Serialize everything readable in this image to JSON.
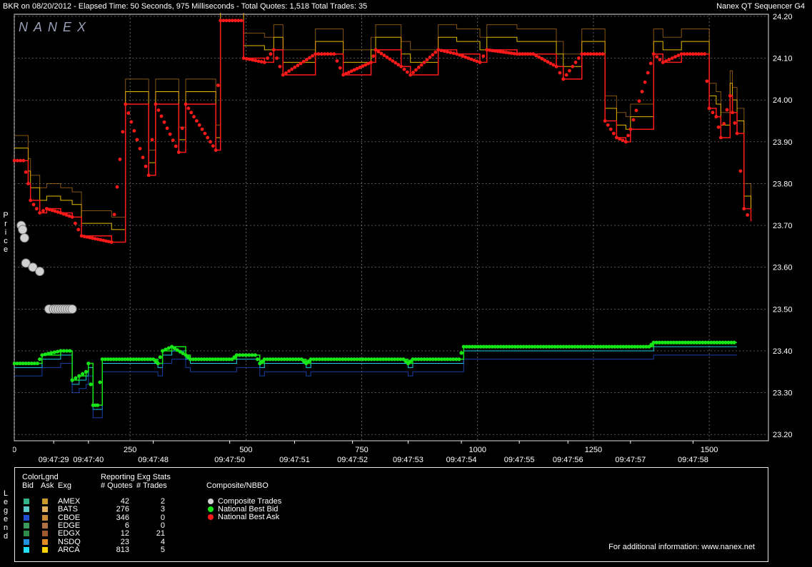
{
  "header": {
    "title": "BKR on 08/20/2012  -  Elapsed Time: 50 Seconds, 975 Milliseconds  -  Total Quotes: 1,518  Total Trades: 35",
    "brand": "Nanex QT Sequencer G4",
    "logo": "NANEX"
  },
  "colors": {
    "bid": "#16e616",
    "ask": "#ff1a1a",
    "trade": "#d0d0d0",
    "grid": "#8a8a8a",
    "amex_bid": "#34b38a",
    "amex_ask": "#c79a2b",
    "bats_bid": "#5ec9c9",
    "bats_ask": "#e0b060",
    "cboe_bid": "#1f4fd0",
    "cboe_ask": "#c98a3a",
    "edge_bid": "#3a9a5a",
    "edge_ask": "#b07040",
    "edgx_bid": "#2e8a4a",
    "edgx_ask": "#a05a30",
    "nsdq_bid": "#2090e0",
    "nsdq_ask": "#e08a20",
    "arca_bid": "#22e0ff",
    "arca_ask": "#ffd000"
  },
  "chart_data": {
    "type": "line",
    "ylabel": "Price",
    "ylim": [
      23.185,
      24.205
    ],
    "xlim": [
      0,
      1600
    ],
    "y_ticks": [
      "24.20",
      "24.10",
      "24.00",
      "23.90",
      "23.80",
      "23.70",
      "23.60",
      "23.50",
      "23.40",
      "23.30",
      "23.20"
    ],
    "x_ticks": [
      {
        "x": 0,
        "label": "0"
      },
      {
        "x": 250,
        "label": "250"
      },
      {
        "x": 500,
        "label": "500"
      },
      {
        "x": 750,
        "label": "750"
      },
      {
        "x": 1000,
        "label": "1000"
      },
      {
        "x": 1250,
        "label": "1250"
      },
      {
        "x": 1500,
        "label": "1500"
      }
    ],
    "time_ticks": [
      {
        "x": 85,
        "label": "09:47:29"
      },
      {
        "x": 160,
        "label": "09:47:40"
      },
      {
        "x": 300,
        "label": "09:47:48"
      },
      {
        "x": 465,
        "label": "09:47:50"
      },
      {
        "x": 605,
        "label": "09:47:51"
      },
      {
        "x": 730,
        "label": "09:47:52"
      },
      {
        "x": 850,
        "label": "09:47:53"
      },
      {
        "x": 965,
        "label": "09:47:54"
      },
      {
        "x": 1090,
        "label": "09:47:55"
      },
      {
        "x": 1195,
        "label": "09:47:56"
      },
      {
        "x": 1330,
        "label": "09:47:57"
      },
      {
        "x": 1465,
        "label": "09:47:58"
      }
    ],
    "series": [
      {
        "name": "National Best Ask",
        "points": [
          [
            0,
            23.855
          ],
          [
            20,
            23.855
          ],
          [
            30,
            23.8
          ],
          [
            35,
            23.76
          ],
          [
            55,
            23.73
          ],
          [
            70,
            23.74
          ],
          [
            100,
            23.73
          ],
          [
            125,
            23.72
          ],
          [
            145,
            23.675
          ],
          [
            210,
            23.66
          ],
          [
            240,
            23.99
          ],
          [
            290,
            23.82
          ],
          [
            305,
            23.99
          ],
          [
            355,
            23.875
          ],
          [
            370,
            23.99
          ],
          [
            435,
            23.88
          ],
          [
            445,
            24.19
          ],
          [
            490,
            24.19
          ],
          [
            495,
            24.1
          ],
          [
            540,
            24.09
          ],
          [
            560,
            24.12
          ],
          [
            580,
            24.06
          ],
          [
            650,
            24.11
          ],
          [
            690,
            24.11
          ],
          [
            710,
            24.06
          ],
          [
            770,
            24.09
          ],
          [
            780,
            24.12
          ],
          [
            835,
            24.08
          ],
          [
            855,
            24.06
          ],
          [
            915,
            24.12
          ],
          [
            955,
            24.11
          ],
          [
            1005,
            24.09
          ],
          [
            1020,
            24.12
          ],
          [
            1085,
            24.11
          ],
          [
            1120,
            24.11
          ],
          [
            1170,
            24.08
          ],
          [
            1185,
            24.05
          ],
          [
            1225,
            24.11
          ],
          [
            1270,
            24.11
          ],
          [
            1275,
            23.95
          ],
          [
            1300,
            23.91
          ],
          [
            1320,
            23.9
          ],
          [
            1330,
            23.93
          ],
          [
            1380,
            24.11
          ],
          [
            1400,
            24.09
          ],
          [
            1440,
            24.11
          ],
          [
            1490,
            24.11
          ],
          [
            1500,
            23.98
          ],
          [
            1515,
            23.96
          ],
          [
            1525,
            23.91
          ],
          [
            1545,
            24.01
          ],
          [
            1550,
            23.97
          ],
          [
            1560,
            23.92
          ],
          [
            1575,
            23.74
          ],
          [
            1590,
            23.71
          ]
        ]
      },
      {
        "name": "National Best Bid",
        "points": [
          [
            0,
            23.37
          ],
          [
            50,
            23.37
          ],
          [
            60,
            23.39
          ],
          [
            100,
            23.4
          ],
          [
            120,
            23.4
          ],
          [
            125,
            23.33
          ],
          [
            140,
            23.34
          ],
          [
            155,
            23.35
          ],
          [
            160,
            23.37
          ],
          [
            170,
            23.27
          ],
          [
            180,
            23.27
          ],
          [
            190,
            23.38
          ],
          [
            300,
            23.38
          ],
          [
            310,
            23.37
          ],
          [
            320,
            23.4
          ],
          [
            340,
            23.41
          ],
          [
            370,
            23.39
          ],
          [
            380,
            23.38
          ],
          [
            470,
            23.38
          ],
          [
            480,
            23.39
          ],
          [
            520,
            23.39
          ],
          [
            530,
            23.37
          ],
          [
            540,
            23.38
          ],
          [
            620,
            23.38
          ],
          [
            630,
            23.37
          ],
          [
            640,
            23.38
          ],
          [
            840,
            23.38
          ],
          [
            850,
            23.37
          ],
          [
            860,
            23.38
          ],
          [
            960,
            23.38
          ],
          [
            970,
            23.41
          ],
          [
            1370,
            23.41
          ],
          [
            1380,
            23.42
          ],
          [
            1560,
            23.42
          ]
        ]
      },
      {
        "name": "Composite Trades",
        "points": [
          [
            15,
            23.7
          ],
          [
            18,
            23.69
          ],
          [
            22,
            23.67
          ],
          [
            25,
            23.61
          ],
          [
            40,
            23.6
          ],
          [
            55,
            23.59
          ],
          [
            75,
            23.5
          ],
          [
            85,
            23.5
          ],
          [
            90,
            23.5
          ],
          [
            95,
            23.5
          ],
          [
            100,
            23.5
          ],
          [
            105,
            23.5
          ],
          [
            110,
            23.5
          ],
          [
            115,
            23.5
          ],
          [
            120,
            23.5
          ],
          [
            125,
            23.5
          ]
        ]
      }
    ]
  },
  "legend": {
    "side_label": "Legend",
    "color_legend_title": "ColorLgnd",
    "col_bid": "Bid",
    "col_ask": "Ask",
    "col_exg": "Exg",
    "stats_title": "Reporting Exg Stats",
    "col_quotes": "# Quotes",
    "col_trades": "# Trades",
    "nbbo_title": "Composite/NBBO",
    "exchanges": [
      {
        "name": "AMEX",
        "quotes": "42",
        "trades": "2",
        "bid_color": "#34b38a",
        "ask_color": "#c79a2b"
      },
      {
        "name": "BATS",
        "quotes": "276",
        "trades": "3",
        "bid_color": "#5ec9c9",
        "ask_color": "#e0b060"
      },
      {
        "name": "CBOE",
        "quotes": "346",
        "trades": "0",
        "bid_color": "#1f4fd0",
        "ask_color": "#c98a3a"
      },
      {
        "name": "EDGE",
        "quotes": "6",
        "trades": "0",
        "bid_color": "#3a9a5a",
        "ask_color": "#b07040"
      },
      {
        "name": "EDGX",
        "quotes": "12",
        "trades": "21",
        "bid_color": "#2e8a4a",
        "ask_color": "#a05a30"
      },
      {
        "name": "NSDQ",
        "quotes": "23",
        "trades": "4",
        "bid_color": "#2090e0",
        "ask_color": "#e08a20"
      },
      {
        "name": "ARCA",
        "quotes": "813",
        "trades": "5",
        "bid_color": "#22e0ff",
        "ask_color": "#ffd000"
      }
    ],
    "nbbo_items": [
      {
        "label": "Composite Trades",
        "color": "#d0d0d0"
      },
      {
        "label": "National Best Bid",
        "color": "#16e616"
      },
      {
        "label": "National Best Ask",
        "color": "#ff1a1a"
      }
    ],
    "footer": "For additional information: www.nanex.net"
  }
}
